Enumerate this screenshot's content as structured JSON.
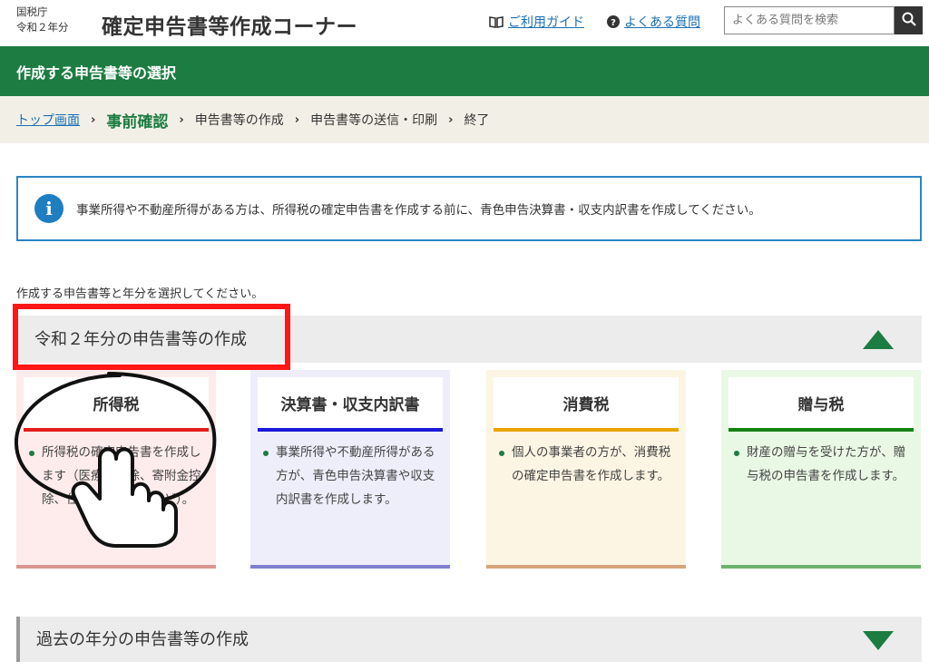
{
  "header": {
    "agency_line1": "国税庁",
    "agency_line2": "令和２年分",
    "title": "確定申告書等作成コーナー",
    "guide_label": "ご利用ガイド",
    "faq_label": "よくある質問",
    "search_placeholder": "よくある質問を検索"
  },
  "section": {
    "title": "作成する申告書等の選択"
  },
  "breadcrumb": {
    "items": [
      {
        "label": "トップ画面"
      },
      {
        "label": "事前確認"
      },
      {
        "label": "申告書等の作成"
      },
      {
        "label": "申告書等の送信・印刷"
      },
      {
        "label": "終了"
      }
    ],
    "separator": "›"
  },
  "info": {
    "icon": "info-icon",
    "icon_glyph": "i",
    "text": "事業所得や不動産所得がある方は、所得税の確定申告書を作成する前に、青色申告決算書・収支内訳書を作成してください。"
  },
  "instruction": "作成する申告書等と年分を選択してください。",
  "current_year": {
    "title": "令和２年分の申告書等の作成",
    "cards": [
      {
        "title": "所得税",
        "desc": "所得税の確定申告書を作成します（医療費控除、寄附金控除、住宅ローン控除など）。",
        "accent": "#e51d1d"
      },
      {
        "title": "決算書・収支内訳書",
        "desc": "事業所得や不動産所得がある方が、青色申告決算書や収支内訳書を作成します。",
        "accent": "#1a1ad8"
      },
      {
        "title": "消費税",
        "desc": "個人の事業者の方が、消費税の確定申告書を作成します。",
        "accent": "#e9a400"
      },
      {
        "title": "贈与税",
        "desc": "財産の贈与を受けた方が、贈与税の申告書を作成します。",
        "accent": "#138213"
      }
    ]
  },
  "past_years": {
    "title": "過去の年分の申告書等の作成"
  },
  "colors": {
    "primary_green": "#1c7c42",
    "link_blue": "#1a6fb3",
    "highlight_red": "#ff1616"
  }
}
